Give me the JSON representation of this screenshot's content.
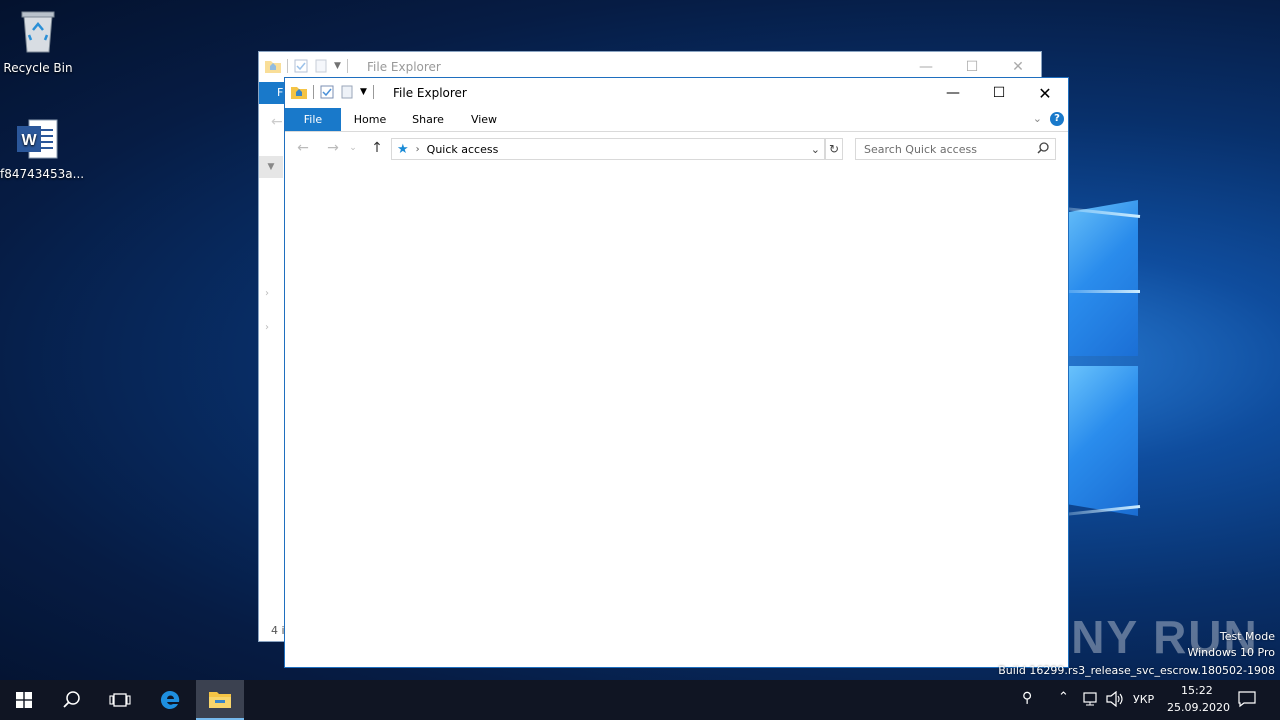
{
  "desktop": {
    "icons": [
      {
        "label": "Recycle Bin",
        "icon": "recycle-bin-icon"
      },
      {
        "label": "f84743453a...",
        "icon": "word-document-icon"
      }
    ]
  },
  "back_window": {
    "title": "File Explorer",
    "file_tab_partial": "F",
    "status_partial": "4 i"
  },
  "front_window": {
    "title": "File Explorer",
    "tabs": [
      "File",
      "Home",
      "Share",
      "View"
    ],
    "address": "Quick access",
    "search_placeholder": "Search Quick access",
    "help_glyph": "?"
  },
  "taskbar": {
    "language": "УКР",
    "time": "15:22",
    "date": "25.09.2020"
  },
  "watermark": {
    "brand": "ANY RUN",
    "line1": "Test Mode",
    "line2": "Windows 10 Pro",
    "line3": "Build 16299.rs3_release_svc_escrow.180502-1908"
  },
  "colors": {
    "accent": "#1979ca",
    "taskbar": "#101523",
    "explorer_folder": "#f5c445"
  }
}
